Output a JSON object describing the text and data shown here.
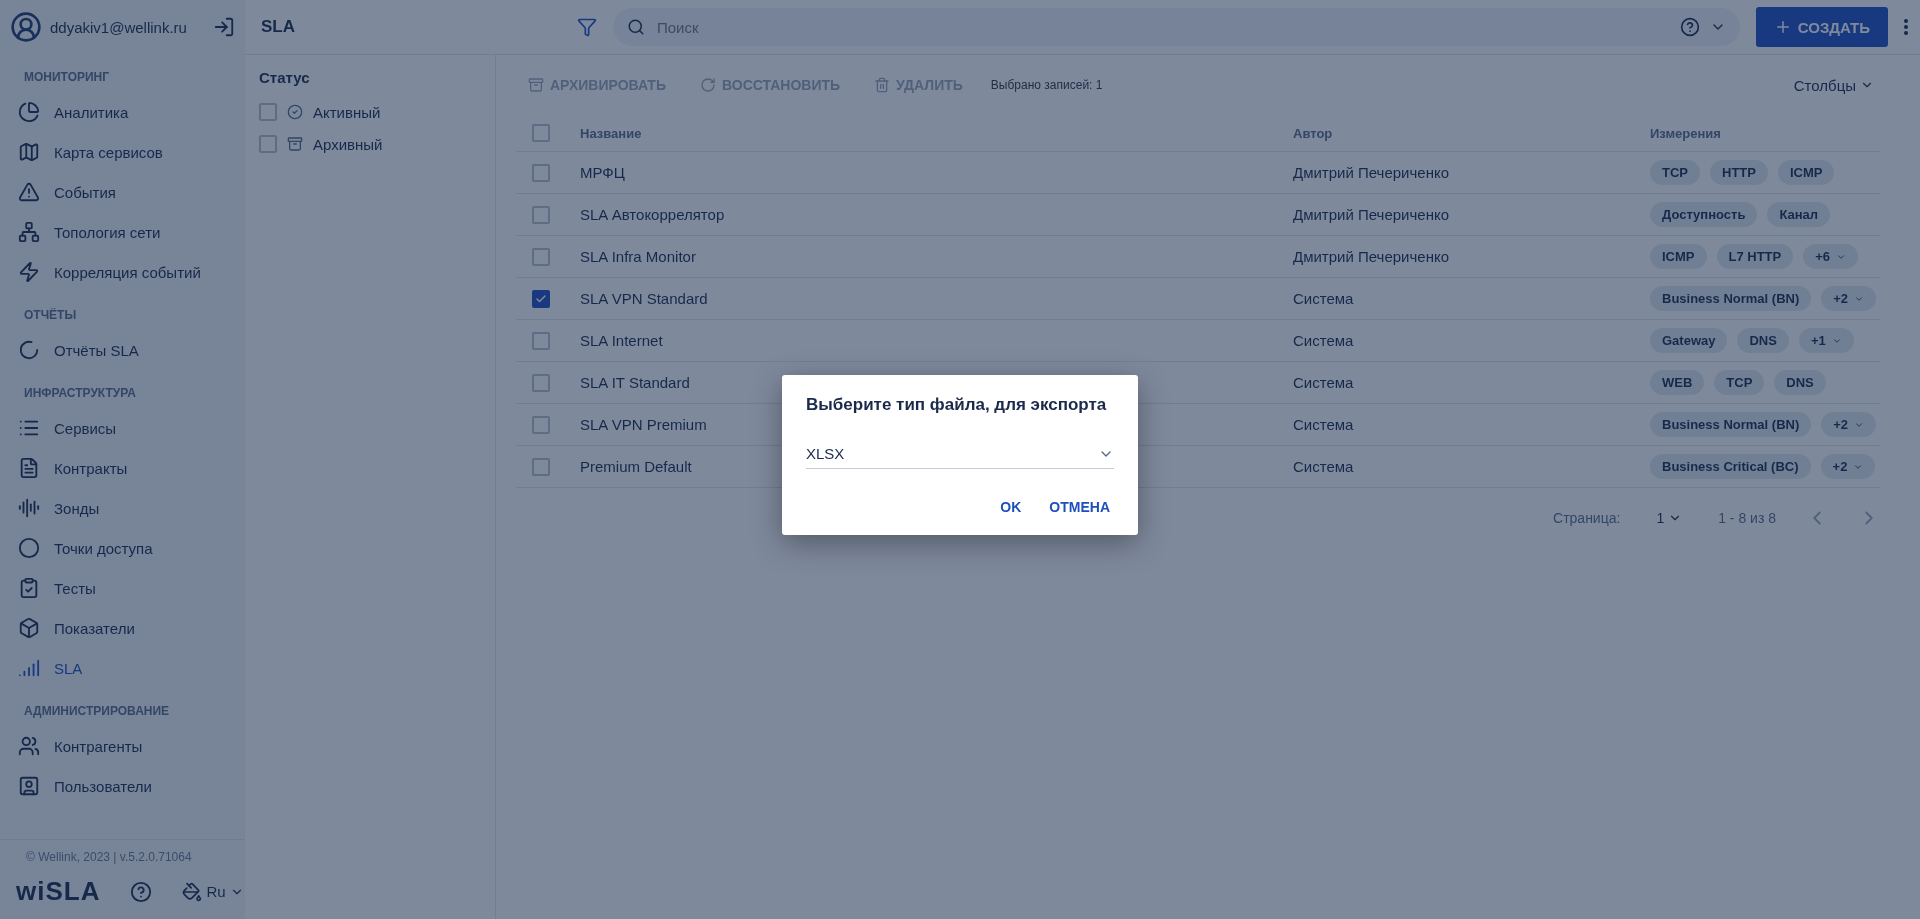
{
  "user": {
    "email": "ddyakiv1@wellink.ru"
  },
  "sidebar": {
    "sections": [
      {
        "title": "МОНИТОРИНГ",
        "items": [
          {
            "label": "Аналитика",
            "selected": false
          },
          {
            "label": "Карта сервисов",
            "selected": false
          },
          {
            "label": "События",
            "selected": false
          },
          {
            "label": "Топология сети",
            "selected": false
          },
          {
            "label": "Корреляция событий",
            "selected": false
          }
        ]
      },
      {
        "title": "ОТЧЁТЫ",
        "items": [
          {
            "label": "Отчёты SLA",
            "selected": false
          }
        ]
      },
      {
        "title": "ИНФРАСТРУКТУРА",
        "items": [
          {
            "label": "Сервисы",
            "selected": false
          },
          {
            "label": "Контракты",
            "selected": false
          },
          {
            "label": "Зонды",
            "selected": false
          },
          {
            "label": "Точки доступа",
            "selected": false
          },
          {
            "label": "Тесты",
            "selected": false
          },
          {
            "label": "Показатели",
            "selected": false
          },
          {
            "label": "SLA",
            "selected": true
          }
        ]
      },
      {
        "title": "АДМИНИСТРИРОВАНИЕ",
        "items": [
          {
            "label": "Контрагенты",
            "selected": false
          },
          {
            "label": "Пользователи",
            "selected": false
          }
        ]
      }
    ],
    "copyright": "© Wellink, 2023 | v.5.2.0.71064",
    "logo": "wiSLA",
    "language": "Ru"
  },
  "header": {
    "title": "SLA",
    "search_placeholder": "Поиск",
    "create_button": "СОЗДАТЬ"
  },
  "filters": {
    "title": "Статус",
    "options": [
      {
        "label": "Активный",
        "checked": false
      },
      {
        "label": "Архивный",
        "checked": false
      }
    ]
  },
  "toolbar": {
    "actions": [
      {
        "label": "АРХИВИРОВАТЬ",
        "disabled": true
      },
      {
        "label": "ВОССТАНОВИТЬ",
        "disabled": true
      },
      {
        "label": "УДАЛИТЬ",
        "disabled": true
      }
    ],
    "selection_info": "Выбрано записей: 1",
    "columns_button": "Столбцы"
  },
  "table": {
    "columns": [
      "Название",
      "Автор",
      "Измерения"
    ],
    "all_checked": false,
    "rows": [
      {
        "name": "МРФЦ",
        "author": "Дмитрий Печериченко",
        "checked": false,
        "tags": [
          {
            "label": "TCP",
            "kind": "tag"
          },
          {
            "label": "HTTP",
            "kind": "tag"
          },
          {
            "label": "ICMP",
            "kind": "tag"
          }
        ]
      },
      {
        "name": "SLA Автокоррелятор",
        "author": "Дмитрий Печериченко",
        "checked": false,
        "tags": [
          {
            "label": "Доступность",
            "kind": "tag"
          },
          {
            "label": "Канал",
            "kind": "tag"
          }
        ]
      },
      {
        "name": "SLA Infra Monitor",
        "author": "Дмитрий Печериченко",
        "checked": false,
        "tags": [
          {
            "label": "ICMP",
            "kind": "tag"
          },
          {
            "label": "L7 HTTP",
            "kind": "tag"
          },
          {
            "label": "+6",
            "kind": "more"
          }
        ]
      },
      {
        "name": "SLA VPN Standard",
        "author": "Система",
        "checked": true,
        "tags": [
          {
            "label": "Business Normal (BN)",
            "kind": "tag"
          },
          {
            "label": "+2",
            "kind": "more"
          }
        ]
      },
      {
        "name": "SLA Internet",
        "author": "Система",
        "checked": false,
        "tags": [
          {
            "label": "Gateway",
            "kind": "tag"
          },
          {
            "label": "DNS",
            "kind": "tag"
          },
          {
            "label": "+1",
            "kind": "more"
          }
        ]
      },
      {
        "name": "SLA IT Standard",
        "author": "Система",
        "checked": false,
        "tags": [
          {
            "label": "WEB",
            "kind": "tag"
          },
          {
            "label": "TCP",
            "kind": "tag"
          },
          {
            "label": "DNS",
            "kind": "tag"
          }
        ]
      },
      {
        "name": "SLA VPN Premium",
        "author": "Система",
        "checked": false,
        "tags": [
          {
            "label": "Business Normal (BN)",
            "kind": "tag"
          },
          {
            "label": "+2",
            "kind": "more"
          }
        ]
      },
      {
        "name": "Premium Default",
        "author": "Система",
        "checked": false,
        "tags": [
          {
            "label": "Business Critical (BC)",
            "kind": "tag"
          },
          {
            "label": "+2",
            "kind": "more"
          }
        ]
      }
    ]
  },
  "pagination": {
    "label": "Страница:",
    "page": "1",
    "range": "1 - 8 из 8"
  },
  "dialog": {
    "title": "Выберите тип файла, для экспорта",
    "value": "XLSX",
    "buttons": [
      "OK",
      "ОТМЕНА"
    ]
  }
}
